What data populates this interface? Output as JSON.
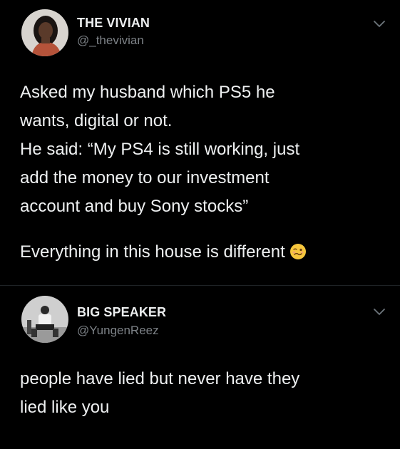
{
  "tweets": [
    {
      "display_name": "THE VIVIAN",
      "handle": "@_thevivian",
      "paragraph_1_lines": [
        "Asked my husband which PS5 he",
        "wants, digital or not.",
        "He said: “My PS4 is still working, just",
        "add the money to our investment",
        "account and buy Sony stocks”"
      ],
      "paragraph_2": "Everything in this house is different",
      "emoji": "woozy-face-emoji"
    },
    {
      "display_name": "BIG SPEAKER",
      "handle": "@YungenReez",
      "body_lines": [
        "people have lied but never have they",
        "lied like you"
      ]
    }
  ],
  "colors": {
    "background": "#000000",
    "text": "#e7e9ea",
    "secondary": "#7d8287",
    "divider": "#1f2326"
  }
}
